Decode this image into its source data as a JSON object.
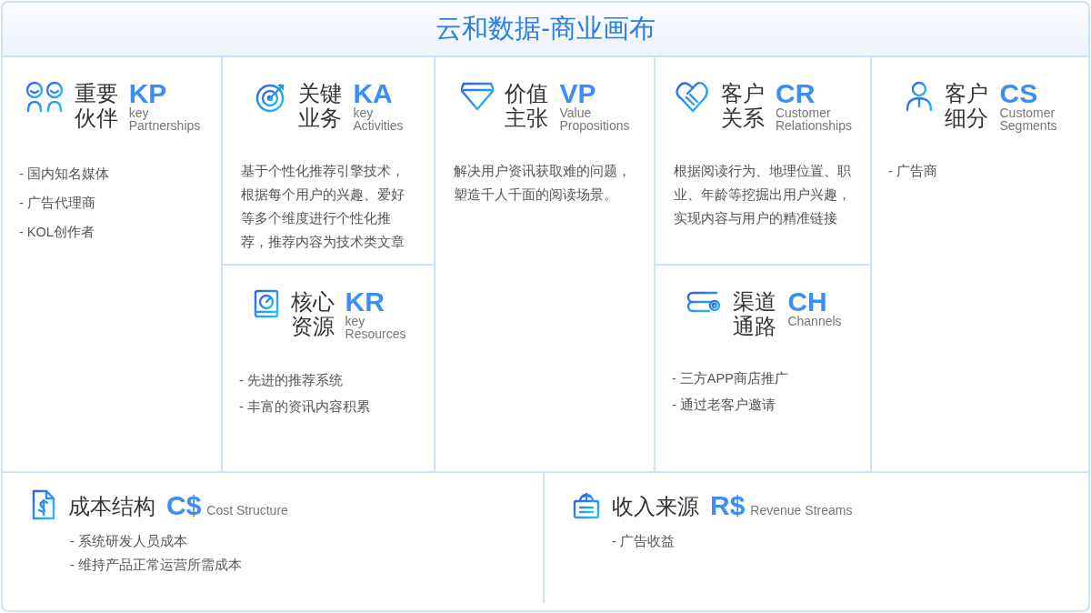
{
  "title": "云和数据-商业画布",
  "columns": [
    {
      "blocks": [
        {
          "cn": "重要伙伴",
          "code": "KP",
          "en": "key Partnerships",
          "kind": "list",
          "items": [
            "- 国内知名媒体",
            "- 广告代理商",
            "- KOL创作者"
          ]
        }
      ]
    },
    {
      "blocks": [
        {
          "cn": "关键业务",
          "code": "KA",
          "en": "key Activities",
          "kind": "text",
          "text": "基于个性化推荐引擎技术，根据每个用户的兴趣、爱好等多个维度进行个性化推荐，推荐内容为技术类文章"
        },
        {
          "cn": "核心资源",
          "code": "KR",
          "en": "key Resources",
          "kind": "list",
          "items": [
            "- 先进的推荐系统",
            "- 丰富的资讯内容积累"
          ]
        }
      ]
    },
    {
      "blocks": [
        {
          "cn": "价值主张",
          "code": "VP",
          "en": "Value Propositions",
          "kind": "text",
          "text": "解决用户资讯获取难的问题，塑造千人千面的阅读场景。"
        }
      ]
    },
    {
      "blocks": [
        {
          "cn": "客户关系",
          "code": "CR",
          "en": "Customer Relationships",
          "kind": "text",
          "text": "根据阅读行为、地理位置、职业、年龄等挖掘出用户兴趣，实现内容与用户的精准链接"
        },
        {
          "cn": "渠道通路",
          "code": "CH",
          "en": "Channels",
          "kind": "list",
          "items": [
            "- 三方APP商店推广",
            "- 通过老客户邀请"
          ]
        }
      ]
    },
    {
      "blocks": [
        {
          "cn": "客户细分",
          "code": "CS",
          "en": "Customer Segments",
          "kind": "list",
          "items": [
            "- 广告商"
          ]
        }
      ]
    }
  ],
  "bottom": [
    {
      "cn": "成本结构",
      "code": "C$",
      "en": "Cost Structure",
      "items": [
        "- 系统研发人员成本",
        "- 维持产品正常运营所需成本"
      ]
    },
    {
      "cn": "收入来源",
      "code": "R$",
      "en": "Revenue Streams",
      "items": [
        "- 广告收益"
      ]
    }
  ]
}
